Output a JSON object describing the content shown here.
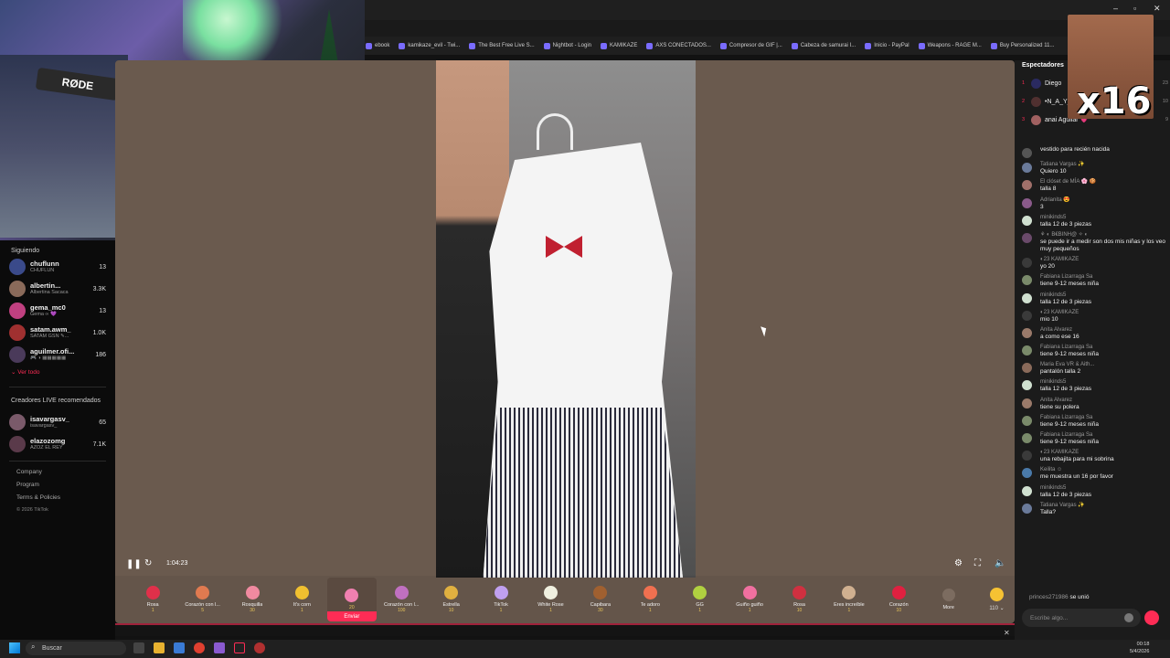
{
  "bookmarks": [
    "ebook",
    "kamikaze_evil - Twi...",
    "The Best Free Live S...",
    "Nightbot - Login",
    "KAMIKAZE",
    "AXS CONECTADOS...",
    "Compresor de GIF |...",
    "Cabeza de samurai I...",
    "Inicio - PayPal",
    "Weapons - RAGE M...",
    "Buy Personalized 11..."
  ],
  "webcam": {
    "mic_brand": "RØDE"
  },
  "sidebar": {
    "following_title": "Siguiendo",
    "following": [
      {
        "name": "chuflunn",
        "sub": "CHUFLUN",
        "count": "13",
        "color": "#3a4a8a"
      },
      {
        "name": "albertin...",
        "sub": "Albertina Sacaca",
        "count": "3.3K",
        "color": "#8a6a5a"
      },
      {
        "name": "gema_mc0",
        "sub": "Gema ∞ 💜",
        "count": "13",
        "color": "#c04080"
      },
      {
        "name": "satam.awm_",
        "sub": "SATAM GSN ✎...",
        "count": "1.0K",
        "color": "#a03030"
      },
      {
        "name": "aguilmer.ofi...",
        "sub": "🎮 ◑ ▦▦▦▦▦",
        "count": "186",
        "color": "#4a3a5a"
      }
    ],
    "see_all": "⌄ Ver todo",
    "recommended_title": "Creadores LIVE recomendados",
    "recommended": [
      {
        "name": "isavargasv_",
        "sub": "isavargasv_",
        "count": "65",
        "color": "#7a5a6a"
      },
      {
        "name": "elazozomg",
        "sub": "AZOZ EL REY",
        "count": "7.1K",
        "color": "#5a3a4a"
      }
    ],
    "links": [
      "Company",
      "Program",
      "Terms & Policies"
    ],
    "copyright": "© 2026 TikTok"
  },
  "player": {
    "time": "1:04:23"
  },
  "gifts": [
    {
      "name": "Rosa",
      "price": "1",
      "color": "#e0304a"
    },
    {
      "name": "Corazón con l...",
      "price": "5",
      "color": "#e07a50"
    },
    {
      "name": "Rosquilla",
      "price": "30",
      "color": "#f08aa0"
    },
    {
      "name": "It's corn",
      "price": "1",
      "color": "#f0c030"
    },
    {
      "name": "",
      "price": "20",
      "color": "#f080b0",
      "selected": true,
      "send": "Enviar"
    },
    {
      "name": "Corazón con l...",
      "price": "100",
      "color": "#c070c0"
    },
    {
      "name": "Estrella",
      "price": "10",
      "color": "#e0b040"
    },
    {
      "name": "TikTok",
      "price": "1",
      "color": "#c0a0f0"
    },
    {
      "name": "White Rose",
      "price": "1",
      "color": "#f0f0e0"
    },
    {
      "name": "Capibara",
      "price": "30",
      "color": "#a06030"
    },
    {
      "name": "Te adoro",
      "price": "1",
      "color": "#f07050"
    },
    {
      "name": "GG",
      "price": "1",
      "color": "#b0d040"
    },
    {
      "name": "Guiño guiño",
      "price": "1",
      "color": "#f070a0"
    },
    {
      "name": "Rosa",
      "price": "10",
      "color": "#d03040"
    },
    {
      "name": "Eres increíble",
      "price": "1",
      "color": "#d0b090"
    },
    {
      "name": "Corazón",
      "price": "10",
      "color": "#e02040"
    }
  ],
  "more_label": "More",
  "coins": "110 ⌄",
  "chat": {
    "viewers_title": "Espectadores",
    "viewers": [
      {
        "rank": "1",
        "name": "Diego",
        "count": "23",
        "color": "#2a2a60"
      },
      {
        "rank": "2",
        "name": "•N_A_Y_H...",
        "count": "10",
        "color": "#503030"
      },
      {
        "rank": "3",
        "name": "anai Aguilar 💗",
        "count": "9",
        "color": "#a06060"
      }
    ],
    "overlay_text": "x16",
    "messages": [
      {
        "user": "",
        "text": "vestido para recién nacida",
        "color": "#555"
      },
      {
        "user": "Tatiana Vargas ✨",
        "text": "Quiero 10",
        "color": "#6a7a9a"
      },
      {
        "user": "El clóset de MÍA 🌸 🍪",
        "text": "talla 8",
        "color": "#a0706a"
      },
      {
        "user": "Adrianita 😍",
        "text": "3",
        "color": "#8a5a8a"
      },
      {
        "user": "minikinds5",
        "text": "talla 12 de 3 piezas",
        "color": "#d0e0d0"
      },
      {
        "user": "⚘ ◐ B€BINH@ ✧ ◐",
        "text": "se puede ir a medir son dos mis niñas y los veo muy pequeños",
        "color": "#6a4a6a"
      },
      {
        "user": "◐23 KAMIKAZE",
        "text": "yo 20",
        "color": "#3a3a3a"
      },
      {
        "user": "Fabiana Lizarraga Sa",
        "text": "tiene 9-12 meses niña",
        "color": "#7a8a6a"
      },
      {
        "user": "minikinds5",
        "text": "talla 12 de 3 piezas",
        "color": "#d0e0d0"
      },
      {
        "user": "◐23 KAMIKAZE",
        "text": "mio 10",
        "color": "#3a3a3a"
      },
      {
        "user": "Anita Alvarez",
        "text": "a como ese 16",
        "color": "#9a7a6a"
      },
      {
        "user": "Fabiana Lizarraga Sa",
        "text": "tiene 9-12 meses niña",
        "color": "#7a8a6a"
      },
      {
        "user": "Maria Eva VR & Aith...",
        "text": "pantalón talla 2",
        "color": "#8a6a5a"
      },
      {
        "user": "minikinds5",
        "text": "talla 12 de 3 piezas",
        "color": "#d0e0d0"
      },
      {
        "user": "Anita Alvarez",
        "text": "tiene su polera",
        "color": "#9a7a6a"
      },
      {
        "user": "Fabiana Lizarraga Sa",
        "text": "tiene 9-12 meses niña",
        "color": "#7a8a6a"
      },
      {
        "user": "Fabiana Lizarraga Sa",
        "text": "tiene 9-12 meses niña",
        "color": "#7a8a6a"
      },
      {
        "user": "◐23 KAMIKAZE",
        "text": "una rebajita para mi sobrina",
        "color": "#3a3a3a"
      },
      {
        "user": "Keilita ☺",
        "text": "me muestra un 16 por favor",
        "color": "#4a7aaa"
      },
      {
        "user": "minikinds5",
        "text": "talla 12 de 3 piezas",
        "color": "#d0e0d0"
      },
      {
        "user": "Tatiana Vargas ✨",
        "text": "Talla?",
        "color": "#6a7a9a"
      }
    ],
    "join_user": "princes271986",
    "join_text": "se unió",
    "input_placeholder": "Escribe algo..."
  },
  "taskbar": {
    "search": "Buscar",
    "time": "00:18",
    "date": "5/4/2026"
  }
}
